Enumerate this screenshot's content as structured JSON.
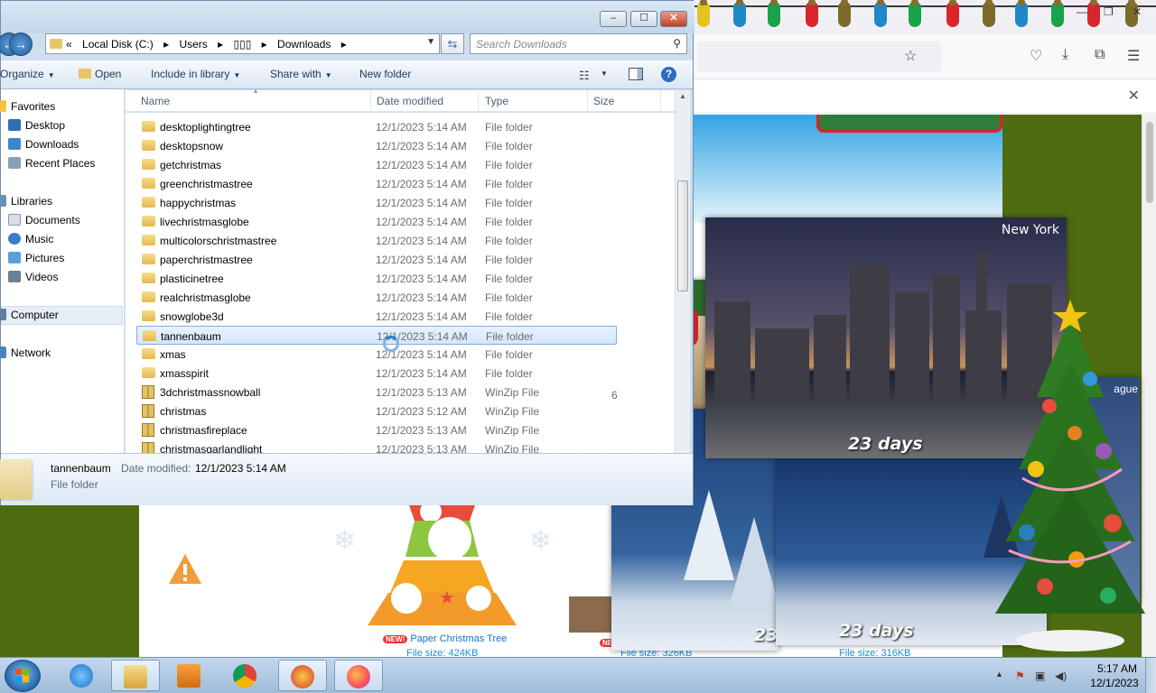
{
  "explorer": {
    "address": {
      "overflow": "«",
      "crumbs": [
        "Local Disk (C:)",
        "Users",
        "▯▯▯",
        "Downloads"
      ],
      "separator": "▸"
    },
    "search_placeholder": "Search Downloads",
    "commands": {
      "organize": "Organize",
      "open": "Open",
      "include_in_library": "Include in library",
      "share_with": "Share with",
      "new_folder": "New folder"
    },
    "nav": {
      "favorites": "Favorites",
      "desktop": "Desktop",
      "downloads": "Downloads",
      "recent_places": "Recent Places",
      "libraries": "Libraries",
      "documents": "Documents",
      "music": "Music",
      "pictures": "Pictures",
      "videos": "Videos",
      "computer": "Computer",
      "network": "Network"
    },
    "columns": {
      "name": "Name",
      "date_modified": "Date modified",
      "type": "Type",
      "size": "Size"
    },
    "files": [
      {
        "name": "desktoplightingtree",
        "date": "12/1/2023 5:14 AM",
        "type": "File folder",
        "kind": "folder"
      },
      {
        "name": "desktopsnow",
        "date": "12/1/2023 5:14 AM",
        "type": "File folder",
        "kind": "folder"
      },
      {
        "name": "getchristmas",
        "date": "12/1/2023 5:14 AM",
        "type": "File folder",
        "kind": "folder"
      },
      {
        "name": "greenchristmastree",
        "date": "12/1/2023 5:14 AM",
        "type": "File folder",
        "kind": "folder"
      },
      {
        "name": "happychristmas",
        "date": "12/1/2023 5:14 AM",
        "type": "File folder",
        "kind": "folder"
      },
      {
        "name": "livechristmasglobe",
        "date": "12/1/2023 5:14 AM",
        "type": "File folder",
        "kind": "folder"
      },
      {
        "name": "multicolorschristmastree",
        "date": "12/1/2023 5:14 AM",
        "type": "File folder",
        "kind": "folder"
      },
      {
        "name": "paperchristmastree",
        "date": "12/1/2023 5:14 AM",
        "type": "File folder",
        "kind": "folder"
      },
      {
        "name": "plasticinetree",
        "date": "12/1/2023 5:14 AM",
        "type": "File folder",
        "kind": "folder"
      },
      {
        "name": "realchristmasglobe",
        "date": "12/1/2023 5:14 AM",
        "type": "File folder",
        "kind": "folder"
      },
      {
        "name": "snowglobe3d",
        "date": "12/1/2023 5:14 AM",
        "type": "File folder",
        "kind": "folder"
      },
      {
        "name": "tannenbaum",
        "date": "12/1/2023 5:14 AM",
        "type": "File folder",
        "kind": "folder",
        "selected": true
      },
      {
        "name": "xmas",
        "date": "12/1/2023 5:14 AM",
        "type": "File folder",
        "kind": "folder"
      },
      {
        "name": "xmasspirit",
        "date": "12/1/2023 5:14 AM",
        "type": "File folder",
        "kind": "folder"
      },
      {
        "name": "3dchristmassnowball",
        "date": "12/1/2023 5:13 AM",
        "type": "WinZip File",
        "kind": "zip"
      },
      {
        "name": "christmas",
        "date": "12/1/2023 5:12 AM",
        "type": "WinZip File",
        "kind": "zip"
      },
      {
        "name": "christmasfireplace",
        "date": "12/1/2023 5:13 AM",
        "type": "WinZip File",
        "kind": "zip"
      },
      {
        "name": "christmasgarlandlight",
        "date": "12/1/2023 5:13 AM",
        "type": "WinZip File",
        "kind": "zip"
      }
    ],
    "partial_size": "6",
    "details": {
      "name": "tannenbaum",
      "date_label": "Date modified:",
      "date": "12/1/2023 5:14 AM",
      "type": "File folder"
    }
  },
  "browser": {
    "page": {
      "paper_tree_new": "NEW!",
      "paper_tree_label": "Paper Christmas Tree",
      "paper_tree_size": "File size: 424KB",
      "size_2": "File size: 326KB",
      "size_3": "File size: 316KB",
      "new_2": "NE"
    },
    "cards": {
      "ny_title": "New York",
      "ny_days": "23 days",
      "winter_days": "23 days",
      "winter_days_partial": "23",
      "prague_title": "ague"
    }
  },
  "taskbar": {
    "time": "5:17 AM",
    "date": "12/1/2023"
  },
  "colors": {
    "page_green": "#4f6b12",
    "selection": "#d4e6fb",
    "explorer_frame": "#cfdff0",
    "taskbar": "#9fbcd8"
  }
}
